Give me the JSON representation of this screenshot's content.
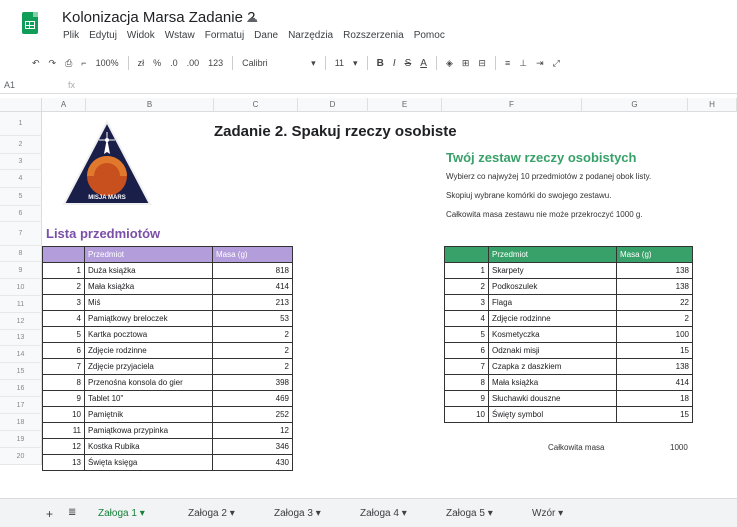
{
  "window": {
    "title": "Kolonizacja Marsa Zadanie 2",
    "menu": [
      "Plik",
      "Edytuj",
      "Widok",
      "Wstaw",
      "Formatuj",
      "Dane",
      "Narzędzia",
      "Rozszerzenia",
      "Pomoc"
    ]
  },
  "toolbar": {
    "zoom": "100%",
    "format_pct": "%",
    "format_dec1": ".0",
    "format_dec2": ".00",
    "format_num": "123",
    "font": "Calibri",
    "font_size": "11",
    "bold": "B",
    "italic": "I",
    "strike": "S",
    "underline": "A"
  },
  "formula_bar": {
    "cell_ref": "A1",
    "fx": "fx"
  },
  "columns": [
    "A",
    "B",
    "C",
    "D",
    "E",
    "F",
    "G",
    "H"
  ],
  "rows": [
    "1",
    "2",
    "3",
    "4",
    "5",
    "6",
    "7",
    "8",
    "9",
    "10",
    "11",
    "12",
    "13",
    "14",
    "15",
    "16",
    "17",
    "18",
    "19",
    "20"
  ],
  "sheet": {
    "main_title": "Zadanie 2. Spakuj rzeczy osobiste",
    "logo_text": "MISJA MARS",
    "green_title": "Twój zestaw rzeczy osobistych",
    "instructions": [
      "Wybierz co najwyżej 10 przedmiotów z podanej obok listy.",
      "Skopiuj wybrane komórki do swojego zestawu.",
      "Całkowita masa zestawu nie może przekroczyć 1000 g."
    ],
    "list_title": "Lista przedmiotów",
    "left_headers": [
      "Przedmiot",
      "Masa (g)"
    ],
    "left_items": [
      {
        "n": "1",
        "name": "Duża książka",
        "mass": "818"
      },
      {
        "n": "2",
        "name": "Mała książka",
        "mass": "414"
      },
      {
        "n": "3",
        "name": "Miś",
        "mass": "213"
      },
      {
        "n": "4",
        "name": "Pamiątkowy breloczek",
        "mass": "53"
      },
      {
        "n": "5",
        "name": "Kartka pocztowa",
        "mass": "2"
      },
      {
        "n": "6",
        "name": "Zdjęcie rodzinne",
        "mass": "2"
      },
      {
        "n": "7",
        "name": "Zdjęcie przyjaciela",
        "mass": "2"
      },
      {
        "n": "8",
        "name": "Przenośna konsola do gier",
        "mass": "398"
      },
      {
        "n": "9",
        "name": "Tablet 10\"",
        "mass": "469"
      },
      {
        "n": "10",
        "name": "Pamiętnik",
        "mass": "252"
      },
      {
        "n": "11",
        "name": "Pamiątkowa przypinka",
        "mass": "12"
      },
      {
        "n": "12",
        "name": "Kostka Rubika",
        "mass": "346"
      },
      {
        "n": "13",
        "name": "Święta księga",
        "mass": "430"
      }
    ],
    "right_headers": [
      "Przedmiot",
      "Masa (g)"
    ],
    "right_items": [
      {
        "n": "1",
        "name": "Skarpety",
        "mass": "138"
      },
      {
        "n": "2",
        "name": "Podkoszulek",
        "mass": "138"
      },
      {
        "n": "3",
        "name": "Flaga",
        "mass": "22"
      },
      {
        "n": "4",
        "name": "Zdjęcie rodzinne",
        "mass": "2"
      },
      {
        "n": "5",
        "name": "Kosmetyczka",
        "mass": "100"
      },
      {
        "n": "6",
        "name": "Odznaki misji",
        "mass": "15"
      },
      {
        "n": "7",
        "name": "Czapka z daszkiem",
        "mass": "138"
      },
      {
        "n": "8",
        "name": "Mała książka",
        "mass": "414"
      },
      {
        "n": "9",
        "name": "Słuchawki douszne",
        "mass": "18"
      },
      {
        "n": "10",
        "name": "Święty symbol",
        "mass": "15"
      }
    ],
    "total_label": "Całkowita masa",
    "total_value": "1000"
  },
  "tabs": [
    {
      "label": "Załoga 1",
      "active": true
    },
    {
      "label": "Załoga 2",
      "active": false
    },
    {
      "label": "Załoga 3",
      "active": false
    },
    {
      "label": "Załoga 4",
      "active": false
    },
    {
      "label": "Załoga 5",
      "active": false
    },
    {
      "label": "Wzór",
      "active": false
    }
  ],
  "colors": {
    "purple_header": "#b39ddb",
    "purple_title": "#7b4fa8",
    "green_header": "#38a169",
    "sheets_green": "#0f9d58"
  }
}
